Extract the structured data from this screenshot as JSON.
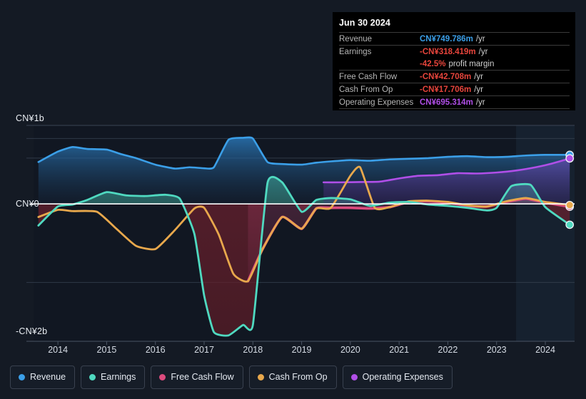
{
  "chart_data": {
    "type": "area",
    "title": "",
    "xlabel": "",
    "ylabel": "",
    "currency": "CN¥",
    "x_tick_labels": [
      "2014",
      "2015",
      "2016",
      "2017",
      "2018",
      "2019",
      "2020",
      "2021",
      "2022",
      "2023",
      "2024"
    ],
    "y_tick_labels": [
      "CN¥1b",
      "CN¥0",
      "-CN¥2b"
    ],
    "y_tick_values": [
      1000,
      0,
      -2000
    ],
    "ylim": [
      -2100,
      1200
    ],
    "xlim": [
      2013.5,
      2024.6
    ],
    "units": "CN¥ millions",
    "grid": true,
    "legend_position": "bottom",
    "forecast_start_year": 2023.4,
    "series": [
      {
        "name": "Revenue",
        "color": "#3B9FE8",
        "x": [
          2013.6,
          2014.0,
          2014.3,
          2014.6,
          2015.0,
          2015.3,
          2015.6,
          2016.0,
          2016.4,
          2016.7,
          2017.0,
          2017.2,
          2017.5,
          2017.8,
          2018.0,
          2018.3,
          2018.6,
          2019.0,
          2019.3,
          2019.6,
          2020.0,
          2020.4,
          2020.8,
          2021.2,
          2021.6,
          2022.0,
          2022.4,
          2022.8,
          2023.2,
          2023.6,
          2024.0,
          2024.5
        ],
        "values": [
          640,
          800,
          870,
          840,
          830,
          760,
          700,
          600,
          540,
          560,
          545,
          560,
          980,
          1010,
          1000,
          640,
          610,
          600,
          630,
          650,
          670,
          660,
          680,
          690,
          700,
          720,
          730,
          715,
          720,
          740,
          750,
          749.786
        ]
      },
      {
        "name": "Earnings",
        "color": "#4FD9C0",
        "x": [
          2013.6,
          2014.0,
          2014.3,
          2014.6,
          2015.0,
          2015.4,
          2015.8,
          2016.2,
          2016.5,
          2016.8,
          2017.0,
          2017.2,
          2017.5,
          2017.8,
          2018.0,
          2018.3,
          2018.6,
          2019.0,
          2019.3,
          2019.6,
          2020.0,
          2020.4,
          2020.8,
          2021.2,
          2021.6,
          2022.0,
          2022.4,
          2022.8,
          2023.0,
          2023.3,
          2023.7,
          2024.0,
          2024.5
        ],
        "values": [
          -330,
          -40,
          -10,
          60,
          180,
          130,
          120,
          140,
          80,
          -460,
          -1400,
          -1960,
          -2010,
          -1850,
          -1850,
          320,
          330,
          -120,
          60,
          90,
          70,
          -30,
          20,
          30,
          -10,
          -30,
          -60,
          -100,
          -60,
          270,
          290,
          -50,
          -318.419
        ]
      },
      {
        "name": "Free Cash Flow",
        "color": "#DC4B7E",
        "x": [
          2017.9,
          2018.2,
          2018.6,
          2019.0,
          2019.3,
          2019.6,
          2020.0,
          2020.4,
          2020.8,
          2021.2,
          2021.6,
          2022.0,
          2022.4,
          2022.8,
          2023.2,
          2023.6,
          2024.0,
          2024.5
        ],
        "values": [
          -1180,
          -690,
          -200,
          -380,
          -70,
          -60,
          -60,
          -70,
          -50,
          30,
          40,
          20,
          -30,
          -40,
          30,
          80,
          20,
          -42.708
        ]
      },
      {
        "name": "Cash From Op",
        "color": "#E8A84C",
        "x": [
          2013.6,
          2014.0,
          2014.3,
          2014.8,
          2015.2,
          2015.6,
          2016.0,
          2016.4,
          2016.8,
          2017.0,
          2017.3,
          2017.6,
          2017.9,
          2018.2,
          2018.6,
          2019.0,
          2019.3,
          2019.6,
          2020.0,
          2020.2,
          2020.5,
          2020.8,
          2021.2,
          2021.6,
          2022.0,
          2022.4,
          2022.8,
          2023.2,
          2023.6,
          2024.0,
          2024.5
        ],
        "values": [
          -200,
          -90,
          -110,
          -120,
          -380,
          -640,
          -690,
          -400,
          -70,
          -60,
          -470,
          -1070,
          -1180,
          -690,
          -200,
          -380,
          -70,
          -60,
          430,
          560,
          -60,
          -50,
          40,
          50,
          30,
          -20,
          -40,
          40,
          90,
          30,
          -17.706
        ]
      },
      {
        "name": "Operating Expenses",
        "color": "#B04FE8",
        "x": [
          2019.45,
          2019.8,
          2020.2,
          2020.6,
          2021.0,
          2021.4,
          2021.8,
          2022.2,
          2022.6,
          2023.0,
          2023.4,
          2023.8,
          2024.1,
          2024.5
        ],
        "values": [
          330,
          330,
          335,
          340,
          390,
          430,
          440,
          470,
          465,
          480,
          510,
          560,
          610,
          695.314
        ]
      }
    ]
  },
  "tooltip": {
    "title": "Jun 30 2024",
    "rows": [
      {
        "key": "Revenue",
        "value": "CN¥749.786m",
        "unit": "/yr",
        "color": "#3B9FE8"
      },
      {
        "key": "Earnings",
        "value": "-CN¥318.419m",
        "unit": "/yr",
        "color": "#E8453C"
      },
      {
        "key": "",
        "value": "-42.5%",
        "unit": "profit margin",
        "color": "#E8453C"
      },
      {
        "key": "Free Cash Flow",
        "value": "-CN¥42.708m",
        "unit": "/yr",
        "color": "#E8453C"
      },
      {
        "key": "Cash From Op",
        "value": "-CN¥17.706m",
        "unit": "/yr",
        "color": "#E8453C"
      },
      {
        "key": "Operating Expenses",
        "value": "CN¥695.314m",
        "unit": "/yr",
        "color": "#B04FE8"
      }
    ]
  },
  "legend": {
    "items": [
      {
        "label": "Revenue",
        "color": "#3B9FE8"
      },
      {
        "label": "Earnings",
        "color": "#4FD9C0"
      },
      {
        "label": "Free Cash Flow",
        "color": "#DC4B7E"
      },
      {
        "label": "Cash From Op",
        "color": "#E8A84C"
      },
      {
        "label": "Operating Expenses",
        "color": "#B04FE8"
      }
    ]
  }
}
